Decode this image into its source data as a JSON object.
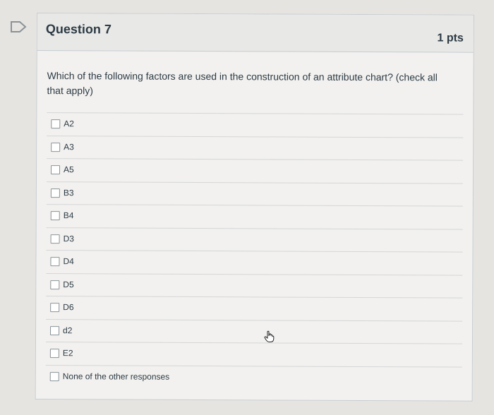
{
  "question": {
    "title": "Question 7",
    "points": "1 pts",
    "text": "Which of the following factors are used in the construction of an attribute chart? (check all that apply)"
  },
  "options": [
    {
      "label": "A2",
      "checked": false
    },
    {
      "label": "A3",
      "checked": false
    },
    {
      "label": "A5",
      "checked": false
    },
    {
      "label": "B3",
      "checked": false
    },
    {
      "label": "B4",
      "checked": false
    },
    {
      "label": "D3",
      "checked": false
    },
    {
      "label": "D4",
      "checked": false
    },
    {
      "label": "D5",
      "checked": false
    },
    {
      "label": "D6",
      "checked": false
    },
    {
      "label": "d2",
      "checked": false
    },
    {
      "label": "E2",
      "checked": false
    },
    {
      "label": "None of the other responses",
      "checked": false
    }
  ],
  "icons": {
    "flag": "bookmark-flag-icon",
    "cursor": "hand-pointer-icon"
  },
  "colors": {
    "card_bg": "#f2f1ef",
    "header_bg": "#e8e8e6",
    "text": "#2d3b45",
    "border": "#c7cdd1"
  }
}
